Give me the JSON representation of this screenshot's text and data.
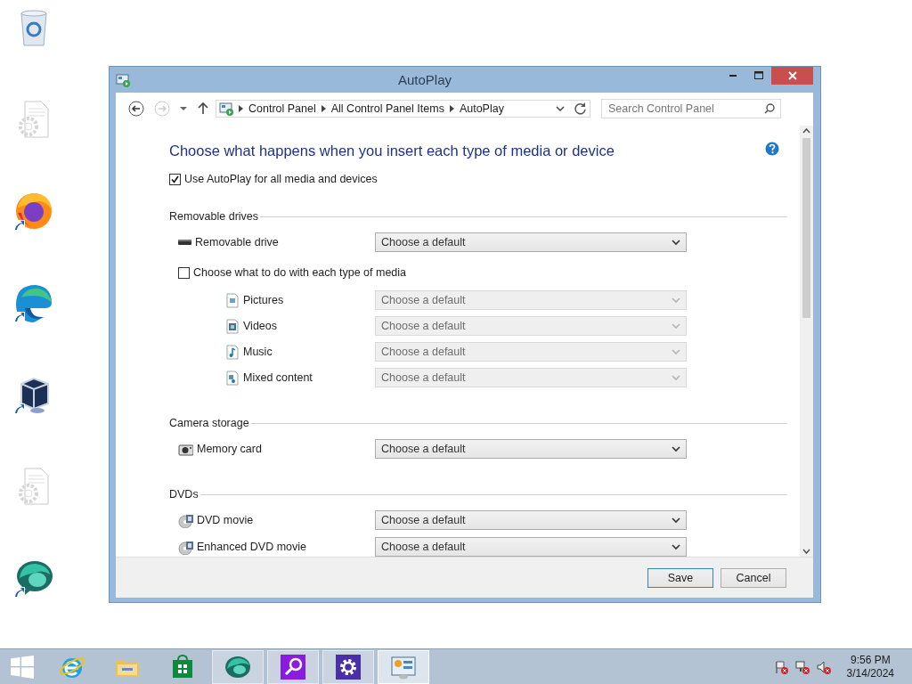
{
  "desktop_icons": [
    {
      "kind": "recycle-bin",
      "shortcut": false
    },
    {
      "kind": "document-gear",
      "shortcut": false
    },
    {
      "kind": "fox-browser",
      "shortcut": true
    },
    {
      "kind": "wave-browser",
      "shortcut": true
    },
    {
      "kind": "cube",
      "shortcut": true
    },
    {
      "kind": "document-gear",
      "shortcut": false
    },
    {
      "kind": "bubble",
      "shortcut": true
    }
  ],
  "window": {
    "title": "AutoPlay",
    "breadcrumbs": [
      "Control Panel",
      "All Control Panel Items",
      "AutoPlay"
    ],
    "search": {
      "placeholder": "Search Control Panel"
    },
    "heading": "Choose what happens when you insert each type of media or device",
    "use_autoplay": {
      "label": "Use AutoPlay for all media and devices",
      "checked": true
    },
    "sections": [
      {
        "title": "Removable drives",
        "items": [
          {
            "kind": "drive",
            "label": "Removable drive",
            "value": "Choose a default",
            "disabled": false
          },
          {
            "kind": "checkbox",
            "label": "Choose what to do with each type of media",
            "checked": false
          },
          {
            "kind": "pictures",
            "label": "Pictures",
            "value": "Choose a default",
            "disabled": true
          },
          {
            "kind": "videos",
            "label": "Videos",
            "value": "Choose a default",
            "disabled": true
          },
          {
            "kind": "music",
            "label": "Music",
            "value": "Choose a default",
            "disabled": true
          },
          {
            "kind": "mixed",
            "label": "Mixed content",
            "value": "Choose a default",
            "disabled": true
          }
        ]
      },
      {
        "title": "Camera storage",
        "items": [
          {
            "kind": "camera",
            "label": "Memory card",
            "value": "Choose a default",
            "disabled": false
          }
        ]
      },
      {
        "title": "DVDs",
        "items": [
          {
            "kind": "disc",
            "label": "DVD movie",
            "value": "Choose a default",
            "disabled": false
          },
          {
            "kind": "disc",
            "label": "Enhanced DVD movie",
            "value": "Choose a default",
            "disabled": false
          }
        ]
      }
    ],
    "buttons": [
      {
        "label": "Save",
        "default": true
      },
      {
        "label": "Cancel",
        "default": false
      }
    ]
  },
  "taskbar": {
    "apps": [
      {
        "kind": "globe-e",
        "running": false,
        "active": false
      },
      {
        "kind": "folder",
        "running": false,
        "active": false
      },
      {
        "kind": "store",
        "running": false,
        "active": false
      },
      {
        "kind": "bubble",
        "running": true,
        "active": false
      },
      {
        "kind": "magnifier",
        "running": true,
        "active": false
      },
      {
        "kind": "gear",
        "running": true,
        "active": false
      },
      {
        "kind": "panel",
        "running": true,
        "active": true
      }
    ],
    "tray": [
      {
        "kind": "flag"
      },
      {
        "kind": "network"
      },
      {
        "kind": "speaker"
      }
    ],
    "clock": {
      "time": "9:56 PM",
      "date": "3/14/2024"
    }
  }
}
